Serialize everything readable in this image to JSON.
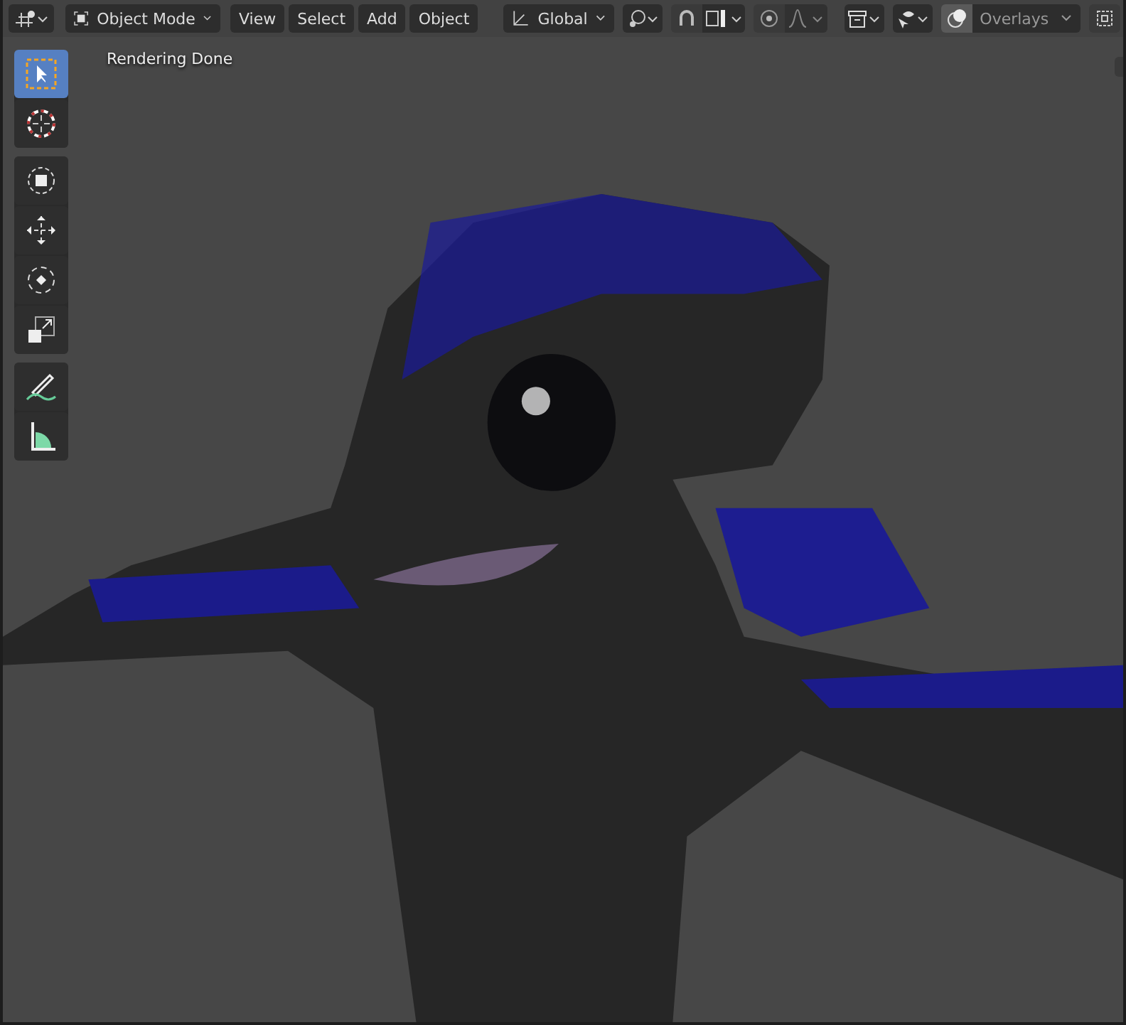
{
  "header": {
    "mode": "Object Mode",
    "menus": [
      "View",
      "Select",
      "Add",
      "Object"
    ],
    "orientation": "Global",
    "toggles": [
      {
        "kind": "snap",
        "on": false
      },
      {
        "kind": "proportional",
        "on": false
      },
      {
        "kind": "overlays",
        "on": true
      },
      {
        "kind": "xray",
        "on": false
      }
    ],
    "overlays_label": "Overlays"
  },
  "status": "Rendering Done",
  "toolbar": [
    [
      {
        "kind": "select",
        "selected": true
      },
      {
        "kind": "cursor",
        "selected": false
      }
    ],
    [
      {
        "kind": "transform",
        "selected": false
      },
      {
        "kind": "move",
        "selected": false
      },
      {
        "kind": "rotate",
        "selected": false
      },
      {
        "kind": "scale",
        "selected": false
      }
    ],
    [
      {
        "kind": "annotate",
        "selected": false
      },
      {
        "kind": "measure",
        "selected": false
      }
    ]
  ]
}
